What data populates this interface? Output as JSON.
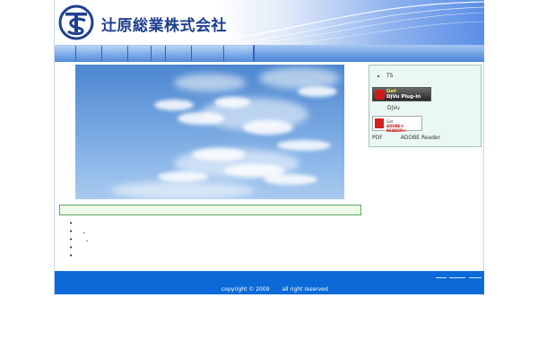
{
  "header": {
    "company_name": "辻原総業株式会社",
    "logo_icon": "ts-logo-icon"
  },
  "nav": {
    "tabs": [
      "",
      "",
      "",
      "",
      "",
      "",
      "",
      ""
    ]
  },
  "main": {
    "photo_icon": "sky-clouds-photo"
  },
  "side_panel": {
    "items": [
      "TS"
    ],
    "djvu_badge": {
      "line1": "Get",
      "line2": "DjVu Plug-in"
    },
    "djvu_label": "DjVu",
    "adobe_badge": {
      "line1": "Get",
      "line2": "ADOBE® READER®"
    },
    "pdf_label": "PDF",
    "adobe_label": "ADOBE Reader"
  },
  "content": {
    "list_items": [
      "",
      "・",
      "・",
      "",
      ""
    ]
  },
  "footer": {
    "copyright": "copyright © 2009",
    "rights": "all right reserved",
    "links": [
      "",
      "",
      ""
    ]
  }
}
